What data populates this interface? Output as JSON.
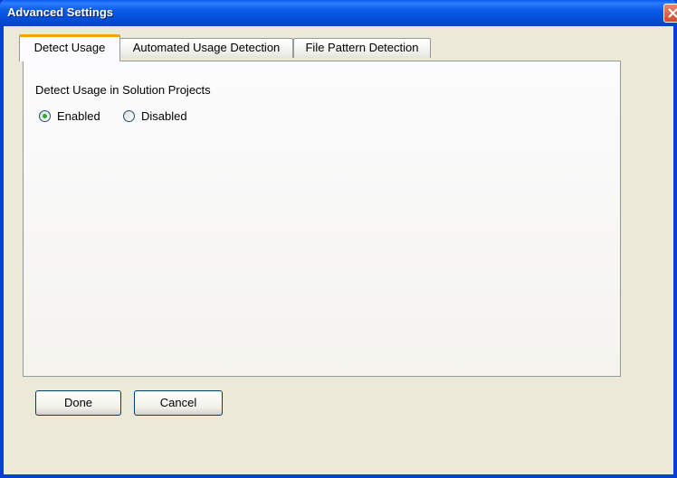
{
  "window": {
    "title": "Advanced Settings"
  },
  "tabs": [
    {
      "label": "Detect Usage",
      "active": true
    },
    {
      "label": "Automated Usage Detection",
      "active": false
    },
    {
      "label": "File Pattern Detection",
      "active": false
    }
  ],
  "detect_usage": {
    "section_label": "Detect Usage in Solution Projects",
    "options": [
      {
        "label": "Enabled",
        "selected": true
      },
      {
        "label": "Disabled",
        "selected": false
      }
    ]
  },
  "buttons": {
    "done_label": "Done",
    "cancel_label": "Cancel"
  },
  "colors": {
    "titlebar": "#0a5af0",
    "window_face": "#ece9d8",
    "active_tab_accent": "#f1a20c",
    "radio_dot": "#2fa82f",
    "close_button": "#d3482a"
  }
}
